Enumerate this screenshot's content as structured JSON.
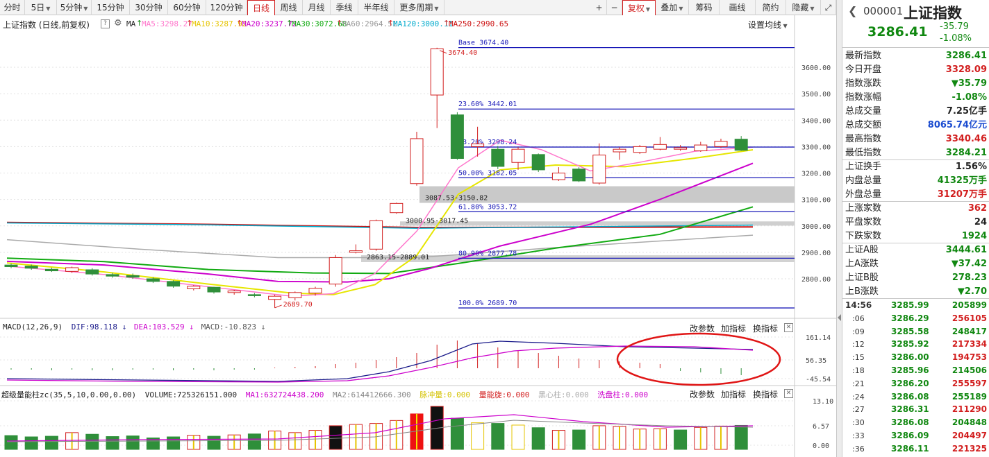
{
  "toolbar": {
    "periods": [
      "分时",
      "5日",
      "5分钟",
      "15分钟",
      "30分钟",
      "60分钟",
      "120分钟",
      "日线",
      "周线",
      "月线",
      "季线",
      "半年线",
      "更多周期"
    ],
    "active_period": "日线",
    "plus": "+",
    "minus": "−",
    "fuquan": "复权",
    "overlay": "叠加",
    "chips": "筹码",
    "draw": "画线",
    "simple": "简约",
    "hide": "隐藏"
  },
  "chart_header": {
    "title": "上证指数 (日线,前复权)",
    "ma_label": "MA",
    "ma": [
      {
        "label": "MA5:3298.27",
        "color": "#ff77cc"
      },
      {
        "label": "MA10:3287.92",
        "color": "#e6c400"
      },
      {
        "label": "MA20:3237.72",
        "color": "#cc00cc"
      },
      {
        "label": "MA30:3072.68",
        "color": "#11aa11"
      },
      {
        "label": "MA60:2964.51",
        "color": "#999999"
      },
      {
        "label": "MA120:3000.11",
        "color": "#00aacc"
      },
      {
        "label": "MA250:2990.65",
        "color": "#cc1111"
      }
    ],
    "settings": "设置均线"
  },
  "macd_header": {
    "title": "MACD(12,26,9)",
    "dif": "DIF:98.118",
    "dea": "DEA:103.529",
    "macd": "MACD:-10.823",
    "change_params": "改参数",
    "add_indicator": "加指标",
    "swap_indicator": "换指标"
  },
  "vol_header": {
    "title": "超级量能柱zc(35,5,10,0.00,0.00)",
    "volume": "VOLUME:725326151.000",
    "ma1": "MA1:632724438.200",
    "ma2": "MA2:614412666.300",
    "pulse": "脉冲量:0.000",
    "spin": "量能旋:0.000",
    "black": "黑心柱:0.000",
    "wash": "洗盘柱:0.000",
    "change_params": "改参数",
    "add_indicator": "加指标",
    "swap_indicator": "换指标"
  },
  "price_axis": [
    "3600.00",
    "3500.00",
    "3400.00",
    "3300.00",
    "3200.00",
    "3100.00",
    "3000.00",
    "2900.00",
    "2800.00"
  ],
  "macd_axis": [
    "161.14",
    "56.35",
    "-45.54"
  ],
  "vol_axis": [
    "13.10",
    "6.57",
    "0.00"
  ],
  "fib": [
    {
      "label": "Base   3674.40",
      "value": 3674.4
    },
    {
      "label": "23.60% 3442.01",
      "value": 3442.01
    },
    {
      "label": "38.20% 3298.24",
      "value": 3298.24
    },
    {
      "label": "50.00% 3182.05",
      "value": 3182.05
    },
    {
      "label": "61.80% 3053.72",
      "value": 3053.72
    },
    {
      "label": "80.90% 2877.78",
      "value": 2877.78
    },
    {
      "label": "100.0% 2689.70",
      "value": 2689.7
    }
  ],
  "annotations": {
    "high": "3674.40",
    "low": "2689.70",
    "gap1": "3087.53-3150.82",
    "gap2": "3000.95-3017.45",
    "gap3": "2863.15-2889.01"
  },
  "chart_data": {
    "type": "candlestick",
    "note_title": "上证指数 日线",
    "ylim": [
      2700,
      3700
    ],
    "candles": [
      {
        "o": 2852,
        "c": 2846,
        "h": 2858,
        "l": 2840
      },
      {
        "o": 2848,
        "c": 2840,
        "h": 2854,
        "l": 2834
      },
      {
        "o": 2836,
        "c": 2830,
        "h": 2842,
        "l": 2826
      },
      {
        "o": 2828,
        "c": 2842,
        "h": 2846,
        "l": 2822
      },
      {
        "o": 2834,
        "c": 2818,
        "h": 2840,
        "l": 2812
      },
      {
        "o": 2816,
        "c": 2810,
        "h": 2822,
        "l": 2804
      },
      {
        "o": 2812,
        "c": 2806,
        "h": 2820,
        "l": 2800
      },
      {
        "o": 2800,
        "c": 2790,
        "h": 2806,
        "l": 2784
      },
      {
        "o": 2790,
        "c": 2772,
        "h": 2794,
        "l": 2766
      },
      {
        "o": 2762,
        "c": 2772,
        "h": 2776,
        "l": 2756
      },
      {
        "o": 2768,
        "c": 2750,
        "h": 2770,
        "l": 2744
      },
      {
        "o": 2748,
        "c": 2754,
        "h": 2758,
        "l": 2740
      },
      {
        "o": 2740,
        "c": 2736,
        "h": 2746,
        "l": 2730
      },
      {
        "o": 2722,
        "c": 2734,
        "h": 2740,
        "l": 2690
      },
      {
        "o": 2728,
        "c": 2748,
        "h": 2752,
        "l": 2718
      },
      {
        "o": 2746,
        "c": 2764,
        "h": 2770,
        "l": 2736
      },
      {
        "o": 2780,
        "c": 2880,
        "h": 2890,
        "l": 2770
      },
      {
        "o": 2900,
        "c": 2906,
        "h": 2930,
        "l": 2896
      },
      {
        "o": 2912,
        "c": 3020,
        "h": 3024,
        "l": 2906
      },
      {
        "o": 3050,
        "c": 3085,
        "h": 3088,
        "l": 3046
      },
      {
        "o": 3160,
        "c": 3330,
        "h": 3356,
        "l": 3152
      },
      {
        "o": 3495,
        "c": 3670,
        "h": 3674,
        "l": 3370
      },
      {
        "o": 3420,
        "c": 3255,
        "h": 3430,
        "l": 3250
      },
      {
        "o": 3300,
        "c": 3310,
        "h": 3375,
        "l": 3262
      },
      {
        "o": 3290,
        "c": 3225,
        "h": 3302,
        "l": 3215
      },
      {
        "o": 3240,
        "c": 3290,
        "h": 3298,
        "l": 3212
      },
      {
        "o": 3270,
        "c": 3212,
        "h": 3274,
        "l": 3204
      },
      {
        "o": 3175,
        "c": 3200,
        "h": 3222,
        "l": 3170
      },
      {
        "o": 3215,
        "c": 3170,
        "h": 3222,
        "l": 3166
      },
      {
        "o": 3162,
        "c": 3268,
        "h": 3312,
        "l": 3156
      },
      {
        "o": 3280,
        "c": 3290,
        "h": 3298,
        "l": 3250
      },
      {
        "o": 3278,
        "c": 3300,
        "h": 3306,
        "l": 3272
      },
      {
        "o": 3290,
        "c": 3308,
        "h": 3336,
        "l": 3286
      },
      {
        "o": 3290,
        "c": 3296,
        "h": 3306,
        "l": 3284
      },
      {
        "o": 3284,
        "c": 3306,
        "h": 3318,
        "l": 3280
      },
      {
        "o": 3300,
        "c": 3320,
        "h": 3330,
        "l": 3294
      },
      {
        "o": 3328,
        "c": 3286,
        "h": 3340,
        "l": 3284
      }
    ],
    "macd_bars": [
      -2,
      -2,
      -3,
      -2,
      -3,
      -3,
      -2,
      -2,
      -3,
      -2,
      -3,
      -2,
      -2,
      1,
      2,
      3,
      6,
      8,
      12,
      16,
      22,
      34,
      40,
      36,
      30,
      26,
      22,
      18,
      14,
      12,
      10,
      8,
      6,
      -4,
      -6,
      -8,
      -10
    ],
    "volume": [
      {
        "v": 4.2,
        "t": "g"
      },
      {
        "v": 3.8,
        "t": "g"
      },
      {
        "v": 4.0,
        "t": "g"
      },
      {
        "v": 5.1,
        "t": "r"
      },
      {
        "v": 4.6,
        "t": "g"
      },
      {
        "v": 3.9,
        "t": "g"
      },
      {
        "v": 4.1,
        "t": "g"
      },
      {
        "v": 3.5,
        "t": "g"
      },
      {
        "v": 3.8,
        "t": "g"
      },
      {
        "v": 4.3,
        "t": "r"
      },
      {
        "v": 4.0,
        "t": "g"
      },
      {
        "v": 4.4,
        "t": "r"
      },
      {
        "v": 4.7,
        "t": "g"
      },
      {
        "v": 5.6,
        "t": "r"
      },
      {
        "v": 5.1,
        "t": "r"
      },
      {
        "v": 5.8,
        "t": "r"
      },
      {
        "v": 7.2,
        "t": "k"
      },
      {
        "v": 7.6,
        "t": "r"
      },
      {
        "v": 7.9,
        "t": "r"
      },
      {
        "v": 8.8,
        "t": "r"
      },
      {
        "v": 10.8,
        "t": "p"
      },
      {
        "v": 13.1,
        "t": "k"
      },
      {
        "v": 9.5,
        "t": "g"
      },
      {
        "v": 8.1,
        "t": "y"
      },
      {
        "v": 7.9,
        "t": "g"
      },
      {
        "v": 7.4,
        "t": "y"
      },
      {
        "v": 6.6,
        "t": "g"
      },
      {
        "v": 5.8,
        "t": "r"
      },
      {
        "v": 5.9,
        "t": "g"
      },
      {
        "v": 7.2,
        "t": "r"
      },
      {
        "v": 7.0,
        "t": "r"
      },
      {
        "v": 6.2,
        "t": "r"
      },
      {
        "v": 6.3,
        "t": "r"
      },
      {
        "v": 5.9,
        "t": "g"
      },
      {
        "v": 6.7,
        "t": "r"
      },
      {
        "v": 7.1,
        "t": "r"
      },
      {
        "v": 7.3,
        "t": "g"
      }
    ]
  },
  "stock": {
    "code": "000001",
    "name": "上证指数",
    "price": "3286.41",
    "change": "-35.79",
    "change_pct": "-1.08%"
  },
  "stats": [
    {
      "k": "最新指数",
      "v": "3286.41",
      "c": "green"
    },
    {
      "k": "今日开盘",
      "v": "3328.09",
      "c": "red"
    },
    {
      "k": "指数涨跌",
      "v": "▼35.79",
      "c": "green"
    },
    {
      "k": "指数涨幅",
      "v": "-1.08%",
      "c": "green"
    },
    {
      "k": "总成交量",
      "v": "7.25亿手",
      "c": "black"
    },
    {
      "k": "总成交额",
      "v": "8065.74亿元",
      "c": "blue"
    },
    {
      "k": "最高指数",
      "v": "3340.46",
      "c": "red"
    },
    {
      "k": "最低指数",
      "v": "3284.21",
      "c": "green"
    },
    {
      "k": "上证换手",
      "v": "1.56%",
      "c": "black"
    },
    {
      "k": "内盘总量",
      "v": "41325万手",
      "c": "green"
    },
    {
      "k": "外盘总量",
      "v": "31207万手",
      "c": "red"
    },
    {
      "k": "上涨家数",
      "v": "362",
      "c": "red"
    },
    {
      "k": "平盘家数",
      "v": "24",
      "c": "black"
    },
    {
      "k": "下跌家数",
      "v": "1924",
      "c": "green"
    },
    {
      "k": "上证A股",
      "v": "3444.61",
      "c": "green"
    },
    {
      "k": "上A涨跌",
      "v": "▼37.42",
      "c": "green"
    },
    {
      "k": "上证B股",
      "v": "278.23",
      "c": "green"
    },
    {
      "k": "上B涨跌",
      "v": "▼2.70",
      "c": "green"
    }
  ],
  "ticks": [
    {
      "t": "14:56",
      "p": "3285.99",
      "v": "205899",
      "c": "green"
    },
    {
      "t": ":06",
      "p": "3286.29",
      "v": "256105",
      "c": "red"
    },
    {
      "t": ":09",
      "p": "3285.58",
      "v": "248417",
      "c": "green"
    },
    {
      "t": ":12",
      "p": "3285.92",
      "v": "217334",
      "c": "red"
    },
    {
      "t": ":15",
      "p": "3286.00",
      "v": "194753",
      "c": "red"
    },
    {
      "t": ":18",
      "p": "3285.96",
      "v": "214506",
      "c": "green"
    },
    {
      "t": ":21",
      "p": "3286.20",
      "v": "255597",
      "c": "red"
    },
    {
      "t": ":24",
      "p": "3286.08",
      "v": "255189",
      "c": "green"
    },
    {
      "t": ":27",
      "p": "3286.31",
      "v": "211290",
      "c": "red"
    },
    {
      "t": ":30",
      "p": "3286.08",
      "v": "204848",
      "c": "green"
    },
    {
      "t": ":33",
      "p": "3286.09",
      "v": "204497",
      "c": "red"
    },
    {
      "t": ":36",
      "p": "3286.11",
      "v": "221325",
      "c": "red"
    }
  ]
}
